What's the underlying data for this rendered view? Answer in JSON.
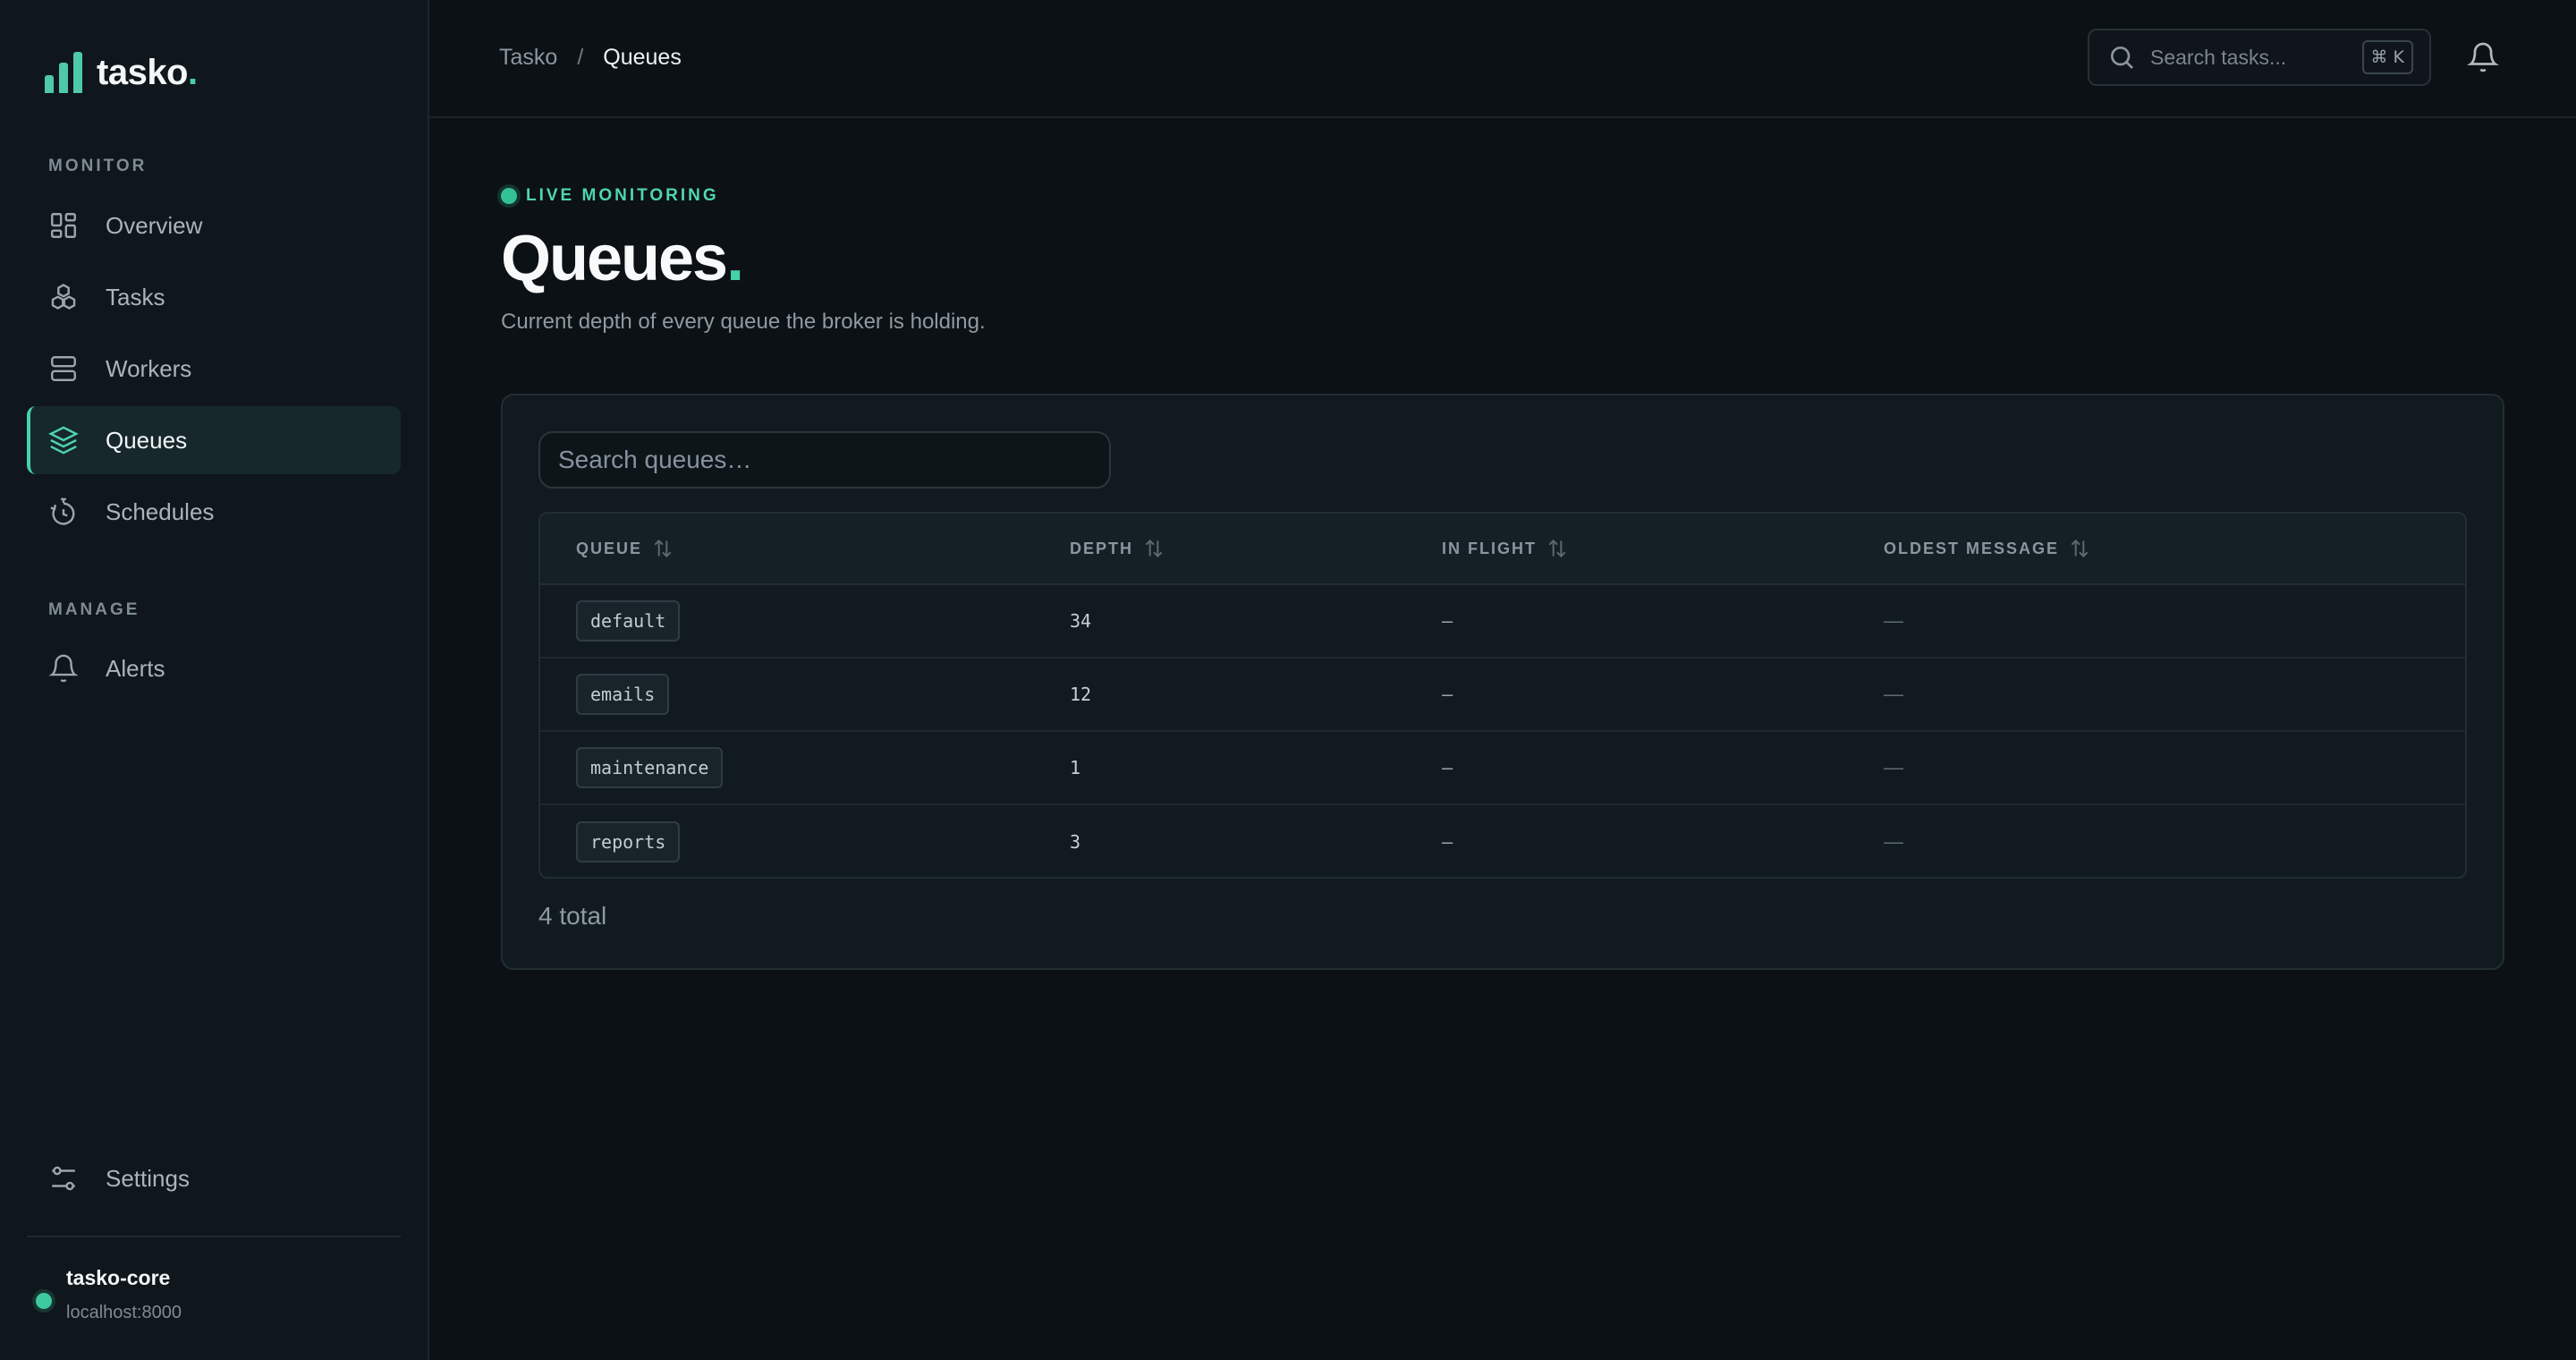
{
  "brand": {
    "name": "tasko",
    "dot": "."
  },
  "sidebar": {
    "sections": [
      {
        "title": "MONITOR"
      },
      {
        "title": "MANAGE"
      }
    ],
    "items": [
      {
        "label": "Overview",
        "icon": "grid-icon"
      },
      {
        "label": "Tasks",
        "icon": "cubes-icon"
      },
      {
        "label": "Workers",
        "icon": "server-icon"
      },
      {
        "label": "Queues",
        "icon": "layers-icon",
        "active": true
      },
      {
        "label": "Schedules",
        "icon": "timer-icon"
      },
      {
        "label": "Alerts",
        "icon": "bell-icon"
      },
      {
        "label": "Settings",
        "icon": "sliders-icon"
      }
    ],
    "server": {
      "name": "tasko-core",
      "host": "localhost:8000",
      "status_color": "#3ec99e"
    }
  },
  "header": {
    "breadcrumb": {
      "root": "Tasko",
      "separator": "/",
      "current": "Queues"
    },
    "search_placeholder": "Search tasks...",
    "shortcut": "⌘ K"
  },
  "page": {
    "live_label": "LIVE MONITORING",
    "title": "Queues",
    "title_dot": ".",
    "subtitle": "Current depth of every queue the broker is holding.",
    "queue_search_placeholder": "Search queues…",
    "total": "4 total"
  },
  "table": {
    "columns": [
      "QUEUE",
      "DEPTH",
      "IN FLIGHT",
      "OLDEST MESSAGE"
    ],
    "rows": [
      {
        "queue": "default",
        "depth": "34",
        "in_flight": "–",
        "oldest": "—"
      },
      {
        "queue": "emails",
        "depth": "12",
        "in_flight": "–",
        "oldest": "—"
      },
      {
        "queue": "maintenance",
        "depth": "1",
        "in_flight": "–",
        "oldest": "—"
      },
      {
        "queue": "reports",
        "depth": "3",
        "in_flight": "–",
        "oldest": "—"
      }
    ]
  },
  "colors": {
    "accent": "#45d1a8",
    "background": "#0c1115",
    "sidebar": "#0f161c"
  }
}
